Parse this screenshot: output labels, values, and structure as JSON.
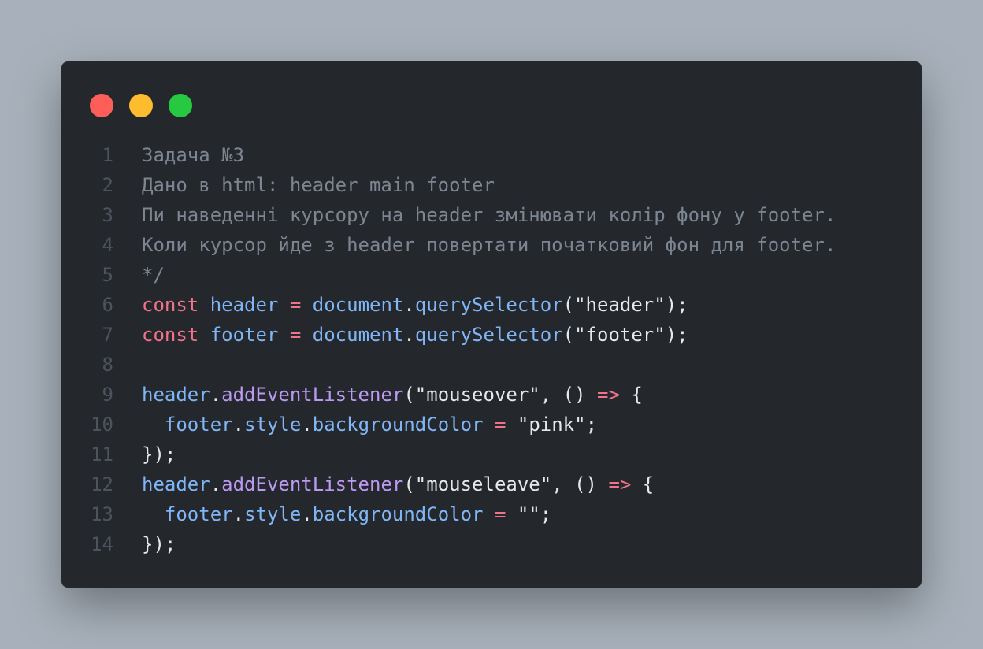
{
  "window": {
    "controls": [
      {
        "name": "close",
        "color": "#fe5e58"
      },
      {
        "name": "minimize",
        "color": "#fdbd2e"
      },
      {
        "name": "maximize",
        "color": "#27c940"
      }
    ]
  },
  "colors": {
    "background": "#a8b1bb",
    "editor": "#24282d",
    "line_number": "#4c535c",
    "comment": "#7c8591",
    "keyword": "#f07389",
    "variable": "#80b6f6",
    "method": "#bc9af2",
    "text": "#e6e8ea"
  },
  "code_lines": [
    {
      "n": "1",
      "tokens": [
        {
          "t": "Задача №3",
          "c": "comment"
        }
      ]
    },
    {
      "n": "2",
      "tokens": [
        {
          "t": "Дано в html: header main footer",
          "c": "comment"
        }
      ]
    },
    {
      "n": "3",
      "tokens": [
        {
          "t": "Пи наведенні курсору на header змінювати колір фону у footer.",
          "c": "comment"
        }
      ]
    },
    {
      "n": "4",
      "tokens": [
        {
          "t": "Коли курсор йде з header повертати початковий фон для footer.",
          "c": "comment"
        }
      ]
    },
    {
      "n": "5",
      "tokens": [
        {
          "t": "*/",
          "c": "comment"
        }
      ]
    },
    {
      "n": "6",
      "tokens": [
        {
          "t": "const",
          "c": "keyword"
        },
        {
          "t": " ",
          "c": "punct"
        },
        {
          "t": "header",
          "c": "var"
        },
        {
          "t": " ",
          "c": "punct"
        },
        {
          "t": "=",
          "c": "op"
        },
        {
          "t": " ",
          "c": "punct"
        },
        {
          "t": "document",
          "c": "var"
        },
        {
          "t": ".",
          "c": "punct"
        },
        {
          "t": "querySelector",
          "c": "var"
        },
        {
          "t": "(",
          "c": "punct"
        },
        {
          "t": "\"header\"",
          "c": "string"
        },
        {
          "t": ");",
          "c": "punct"
        }
      ]
    },
    {
      "n": "7",
      "tokens": [
        {
          "t": "const",
          "c": "keyword"
        },
        {
          "t": " ",
          "c": "punct"
        },
        {
          "t": "footer",
          "c": "var"
        },
        {
          "t": " ",
          "c": "punct"
        },
        {
          "t": "=",
          "c": "op"
        },
        {
          "t": " ",
          "c": "punct"
        },
        {
          "t": "document",
          "c": "var"
        },
        {
          "t": ".",
          "c": "punct"
        },
        {
          "t": "querySelector",
          "c": "var"
        },
        {
          "t": "(",
          "c": "punct"
        },
        {
          "t": "\"footer\"",
          "c": "string"
        },
        {
          "t": ");",
          "c": "punct"
        }
      ]
    },
    {
      "n": "8",
      "tokens": []
    },
    {
      "n": "9",
      "tokens": [
        {
          "t": "header",
          "c": "var"
        },
        {
          "t": ".",
          "c": "punct"
        },
        {
          "t": "addEventListener",
          "c": "method"
        },
        {
          "t": "(",
          "c": "punct"
        },
        {
          "t": "\"mouseover\"",
          "c": "string"
        },
        {
          "t": ", () ",
          "c": "punct"
        },
        {
          "t": "=>",
          "c": "op"
        },
        {
          "t": " {",
          "c": "punct"
        }
      ]
    },
    {
      "n": "10",
      "tokens": [
        {
          "t": "  ",
          "c": "punct"
        },
        {
          "t": "footer",
          "c": "var"
        },
        {
          "t": ".",
          "c": "punct"
        },
        {
          "t": "style",
          "c": "var"
        },
        {
          "t": ".",
          "c": "punct"
        },
        {
          "t": "backgroundColor",
          "c": "var"
        },
        {
          "t": " ",
          "c": "punct"
        },
        {
          "t": "=",
          "c": "op"
        },
        {
          "t": " ",
          "c": "punct"
        },
        {
          "t": "\"pink\"",
          "c": "string"
        },
        {
          "t": ";",
          "c": "punct"
        }
      ]
    },
    {
      "n": "11",
      "tokens": [
        {
          "t": "});",
          "c": "punct"
        }
      ]
    },
    {
      "n": "12",
      "tokens": [
        {
          "t": "header",
          "c": "var"
        },
        {
          "t": ".",
          "c": "punct"
        },
        {
          "t": "addEventListener",
          "c": "method"
        },
        {
          "t": "(",
          "c": "punct"
        },
        {
          "t": "\"mouseleave\"",
          "c": "string"
        },
        {
          "t": ", () ",
          "c": "punct"
        },
        {
          "t": "=>",
          "c": "op"
        },
        {
          "t": " {",
          "c": "punct"
        }
      ]
    },
    {
      "n": "13",
      "tokens": [
        {
          "t": "  ",
          "c": "punct"
        },
        {
          "t": "footer",
          "c": "var"
        },
        {
          "t": ".",
          "c": "punct"
        },
        {
          "t": "style",
          "c": "var"
        },
        {
          "t": ".",
          "c": "punct"
        },
        {
          "t": "backgroundColor",
          "c": "var"
        },
        {
          "t": " ",
          "c": "punct"
        },
        {
          "t": "=",
          "c": "op"
        },
        {
          "t": " ",
          "c": "punct"
        },
        {
          "t": "\"\"",
          "c": "string"
        },
        {
          "t": ";",
          "c": "punct"
        }
      ]
    },
    {
      "n": "14",
      "tokens": [
        {
          "t": "});",
          "c": "punct"
        }
      ]
    }
  ]
}
